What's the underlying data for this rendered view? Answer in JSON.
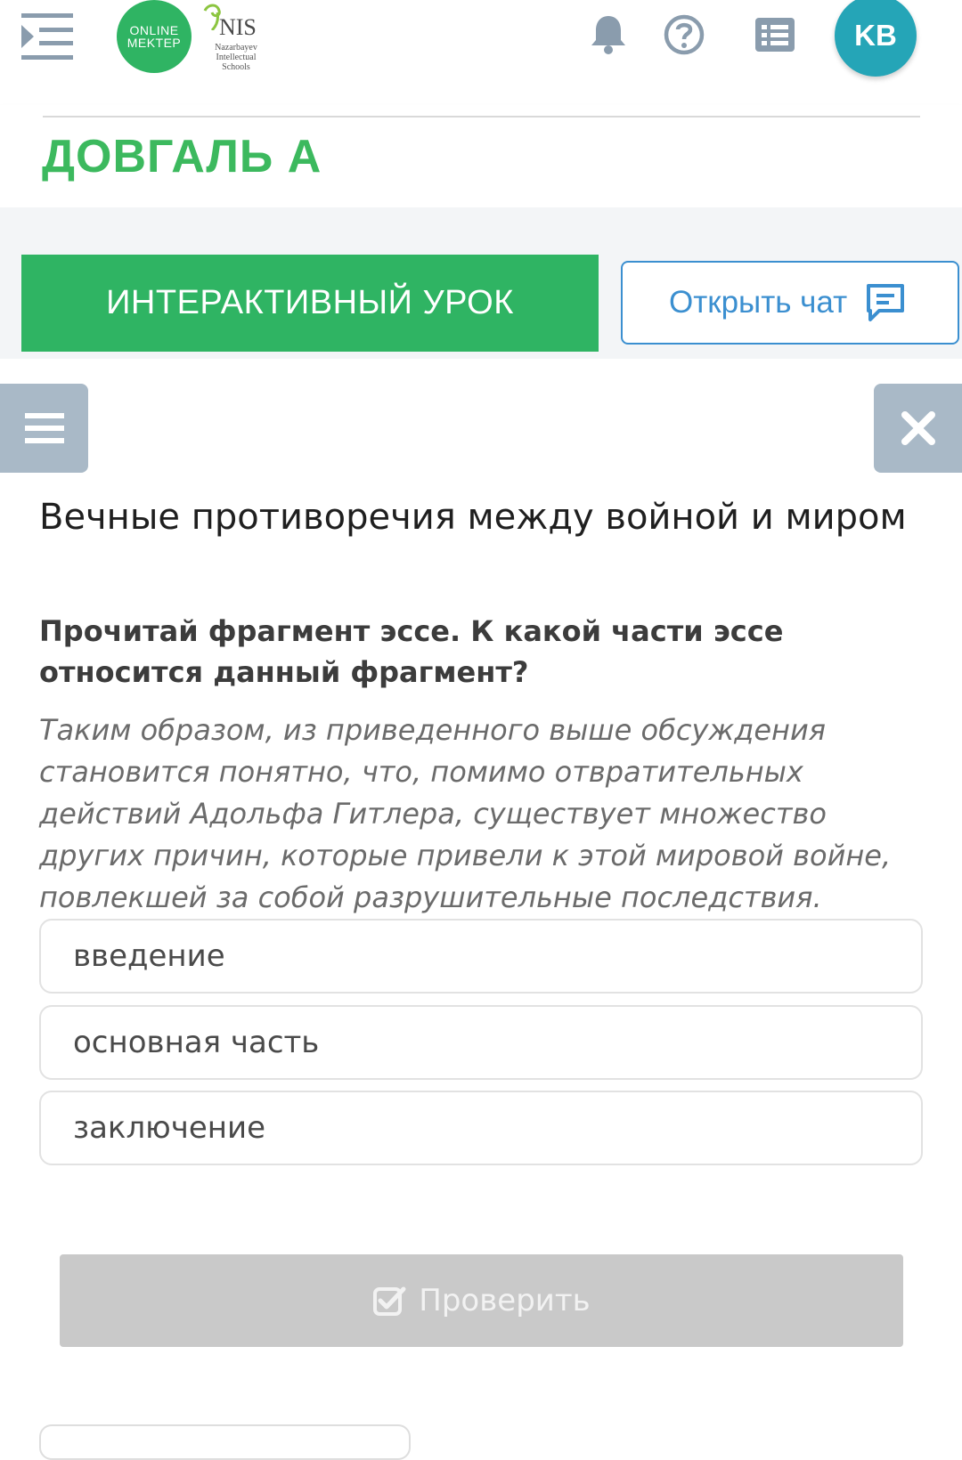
{
  "header": {
    "logo_line1": "ONLINE",
    "logo_line2": "MEKTEP",
    "nis_title": "NIS",
    "nis_sub": "Nazarbayev Intellectual Schools",
    "avatar_initials": "KB"
  },
  "student": {
    "name": "ДОВГАЛЬ А"
  },
  "actions": {
    "interactive_lesson": "ИНТЕРАКТИВНЫЙ УРОК",
    "open_chat": "Открыть чат"
  },
  "lesson": {
    "title": "Вечные противоречия между войной и миром",
    "question": "Прочитай фрагмент эссе. К какой части эссе относится данный фрагмент?",
    "fragment": "Таким образом, из приведенного выше обсуждения становится понятно, что, помимо отвратительных действий Адольфа Гитлера, существует множество других причин, которые привели к этой мировой войне, повлекшей за собой разрушительные последствия.",
    "options": [
      "введение",
      "основная часть",
      "заключение"
    ],
    "check_label": "Проверить"
  },
  "colors": {
    "brand_green": "#2fb463",
    "name_green": "#3cb95e",
    "chat_blue": "#3b8fd0",
    "avatar_teal": "#25a5b7",
    "icon_gray": "#a9b9c7",
    "disabled_gray": "#c9c9c9"
  },
  "icons": [
    "sidebar-toggle-icon",
    "bell-icon",
    "help-icon",
    "list-icon",
    "chat-icon",
    "menu-icon",
    "close-icon",
    "check-square-icon"
  ]
}
